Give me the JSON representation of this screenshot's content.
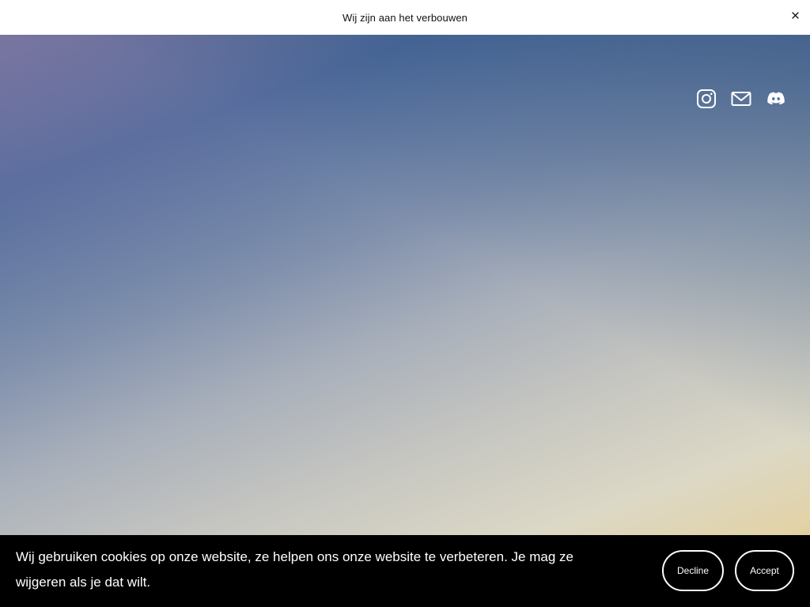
{
  "announcement": {
    "text": "Wij zijn aan het verbouwen",
    "close_icon": "close-icon"
  },
  "social": {
    "items": [
      {
        "name": "instagram",
        "icon": "instagram-icon"
      },
      {
        "name": "email",
        "icon": "mail-icon"
      },
      {
        "name": "discord",
        "icon": "discord-icon"
      }
    ]
  },
  "cookie_banner": {
    "text": "Wij gebruiken cookies op onze website, ze helpen ons onze website te verbeteren. Je mag ze wijgeren als je dat wilt.",
    "decline_label": "Decline",
    "accept_label": "Accept"
  },
  "colors": {
    "banner_bg": "#000000",
    "announcement_bg": "#ffffff",
    "icon_color": "#ffffff"
  }
}
